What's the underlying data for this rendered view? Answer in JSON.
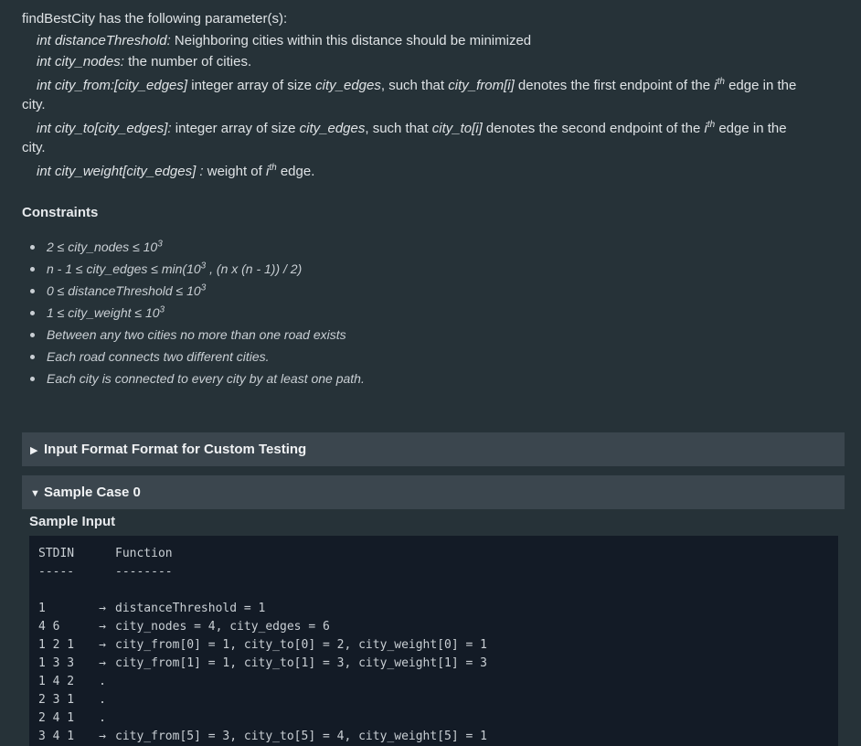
{
  "params": {
    "intro": "findBestCity has the following parameter(s):",
    "p1": {
      "type_name": "int distanceThreshold",
      "colon": ":",
      "desc": " Neighboring cities within this distance should be minimized"
    },
    "p2": {
      "type_name": "int city_nodes",
      "colon": ":",
      "desc": " the number of cities."
    },
    "p3": {
      "type_name": "int city_from:[city_edges]",
      "desc1": " integer array of size ",
      "var1": "city_edges",
      "desc2": ", such that ",
      "var2": "city_from[i]",
      "desc3": " denotes the first endpoint of the ",
      "sup_base": "i",
      "sup": "th",
      "desc4": " edge in the",
      "wrap": "city."
    },
    "p4": {
      "type_name": "int city_to[city_edges]:",
      "desc1": " integer array of size ",
      "var1": "city_edges",
      "desc2": ", such that ",
      "var2": "city_to[i]",
      "desc3": " denotes the second endpoint of the ",
      "sup_base": "i",
      "sup": "th",
      "desc4": " edge in the",
      "wrap": "city."
    },
    "p5": {
      "type_name": "int city_weight[city_edges] :",
      "desc1": " weight of ",
      "sup_base": "i",
      "sup": "th",
      "desc2": " edge."
    }
  },
  "constraints": {
    "heading": "Constraints",
    "c1": {
      "text": "2 ≤ city_nodes ≤ 10",
      "sup": "3"
    },
    "c2": {
      "text1": "n - 1 ≤ city_edges ≤ min(10",
      "sup": "3",
      "text2": " , (n x (n - 1)) / 2)"
    },
    "c3": {
      "text": "0 ≤ distanceThreshold ≤ 10",
      "sup": "3"
    },
    "c4": {
      "text": "1 ≤ city_weight ≤ 10",
      "sup": "3"
    },
    "c5": "Between any two cities no more than one road exists",
    "c6": "Each road connects two different cities.",
    "c7": "Each city is connected to every city by at least one path."
  },
  "panels": {
    "input_format": {
      "icon": "triangle-right-icon",
      "glyph": "▶",
      "label": "Input Format Format for Custom Testing"
    },
    "sample_case": {
      "icon": "triangle-down-icon",
      "glyph": "▼",
      "label": "Sample Case 0"
    }
  },
  "sample": {
    "title": "Sample Input",
    "rows": [
      {
        "c1": "STDIN",
        "c2": "",
        "c3": "Function"
      },
      {
        "c1": "-----",
        "c2": "",
        "c3": "--------"
      },
      {
        "c1": "",
        "c2": "",
        "c3": ""
      },
      {
        "c1": "1",
        "c2": "→",
        "c3": "distanceThreshold = 1"
      },
      {
        "c1": "4 6",
        "c2": "→",
        "c3": "city_nodes = 4, city_edges = 6"
      },
      {
        "c1": "1 2 1",
        "c2": "→",
        "c3": "city_from[0] = 1, city_to[0] = 2, city_weight[0] = 1"
      },
      {
        "c1": "1 3 3",
        "c2": "→",
        "c3": "city_from[1] = 1, city_to[1] = 3, city_weight[1] = 3"
      },
      {
        "c1": "1 4 2",
        "c2": ".",
        "c3": ""
      },
      {
        "c1": "2 3 1",
        "c2": ".",
        "c3": ""
      },
      {
        "c1": "2 4 1",
        "c2": ".",
        "c3": ""
      },
      {
        "c1": "3 4 1",
        "c2": "→",
        "c3": "city_from[5] = 3, city_to[5] = 4, city_weight[5] = 1"
      }
    ]
  }
}
